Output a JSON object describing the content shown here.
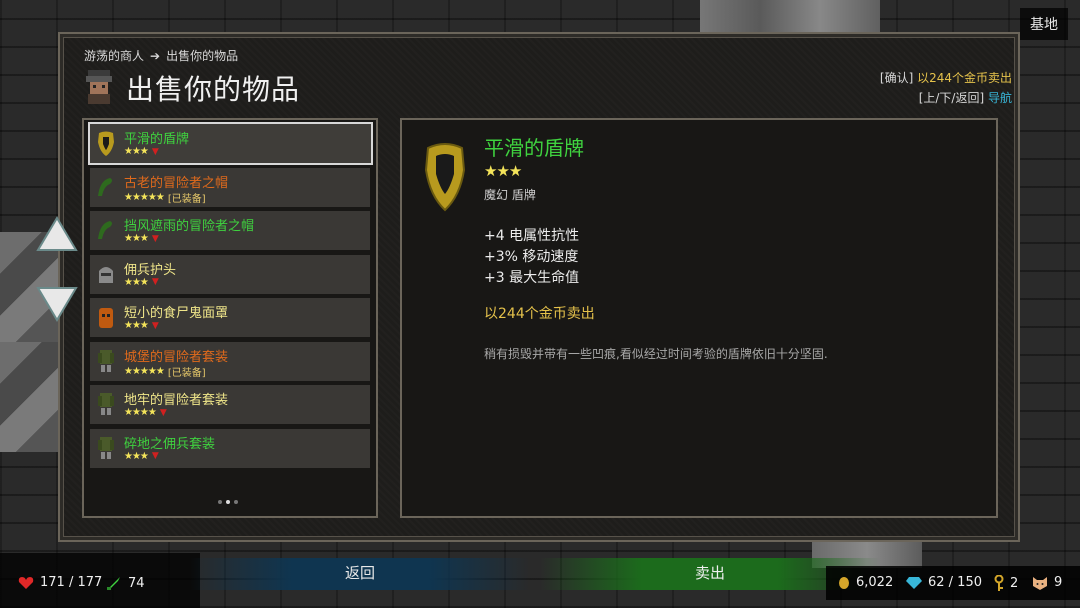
{
  "location": "基地",
  "breadcrumb": {
    "parent": "游荡的商人",
    "arrow": "➔",
    "current": "出售你的物品"
  },
  "title": "出售你的物品",
  "hints": {
    "confirm_key": "[确认]",
    "confirm_text": "以244个金币卖出",
    "nav_key": "[上/下/返回]",
    "nav_text": "导航"
  },
  "items": [
    {
      "name": "平滑的盾牌",
      "stars": "★★★",
      "trend": "▼",
      "equipped": "",
      "color": "#3fd23f",
      "selected": true,
      "icon": "shield-icon"
    },
    {
      "name": "古老的冒险者之帽",
      "stars": "★★★★★",
      "trend": "",
      "equipped": "[已装备]",
      "color": "#e06a1c",
      "selected": false,
      "icon": "hat-icon"
    },
    {
      "name": "挡风遮雨的冒险者之帽",
      "stars": "★★★",
      "trend": "▼",
      "equipped": "",
      "color": "#3fd23f",
      "selected": false,
      "icon": "hat-icon"
    },
    {
      "name": "佣兵护头",
      "stars": "★★★",
      "trend": "▼",
      "equipped": "",
      "color": "#f0e68a",
      "selected": false,
      "icon": "helmet-icon"
    },
    {
      "name": "短小的食尸鬼面罩",
      "stars": "★★★",
      "trend": "▼",
      "equipped": "",
      "color": "#f0e68a",
      "selected": false,
      "icon": "mask-icon"
    },
    {
      "name": "城堡的冒险者套装",
      "stars": "★★★★★",
      "trend": "",
      "equipped": "[已装备]",
      "color": "#e06a1c",
      "selected": false,
      "icon": "armor-icon"
    },
    {
      "name": "地牢的冒险者套装",
      "stars": "★★★★",
      "trend": "▼",
      "equipped": "",
      "color": "#f0e68a",
      "selected": false,
      "icon": "armor-icon"
    },
    {
      "name": "碎地之佣兵套装",
      "stars": "★★★",
      "trend": "▼",
      "equipped": "",
      "color": "#3fd23f",
      "selected": false,
      "icon": "armor-icon"
    }
  ],
  "detail": {
    "name": "平滑的盾牌",
    "stars": "★★★",
    "type": "魔幻 盾牌",
    "stats": [
      "+4 电属性抗性",
      "+3% 移动速度",
      "+3 最大生命值"
    ],
    "sell_price": "以244个金币卖出",
    "description": "稍有损毁并带有一些凹痕,看似经过时间考验的盾牌依旧十分坚固."
  },
  "player": {
    "health": "171 / 177",
    "attack": "74"
  },
  "buttons": {
    "back": "返回",
    "sell": "卖出"
  },
  "resources": {
    "gold": "6,022",
    "gems": "62 / 150",
    "keys": "2",
    "pets": "9"
  },
  "colors": {
    "rarity_green": "#3fd23f",
    "rarity_orange": "#e06a1c",
    "rarity_yellow": "#f0e68a",
    "gold": "#e5c24b"
  }
}
